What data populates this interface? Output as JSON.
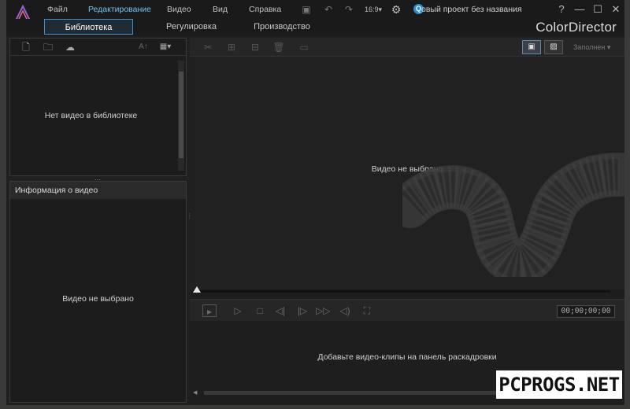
{
  "menu": {
    "items": [
      "Файл",
      "Редактирование",
      "Видео",
      "Вид",
      "Справка"
    ],
    "active": "Редактирование"
  },
  "project_title": "овый проект без названия",
  "project_badge": "Q",
  "window": {
    "help": "?",
    "minimize": "—",
    "maximize": "☐",
    "close": "✕"
  },
  "tabs": [
    "Библиотека",
    "Регулировка",
    "Производство"
  ],
  "brand": "ColorDirector",
  "library": {
    "empty_text": "Нет видео в библиотеке",
    "text_size_label": "A↑"
  },
  "info": {
    "header": "Информация о видео",
    "empty_text": "Видео не выбрано"
  },
  "preview": {
    "empty_text": "Видео не выбрано",
    "fill_label": "Заполнен"
  },
  "playback": {
    "timecode": "00;00;00;00"
  },
  "storyboard": {
    "hint": "Добавьте видео-клипы на панель раскадровки"
  },
  "watermark": "PCPROGS.NET",
  "colors": {
    "accent": "#6cc4f0",
    "tab_border": "#3f8fca",
    "background": "#202020"
  }
}
